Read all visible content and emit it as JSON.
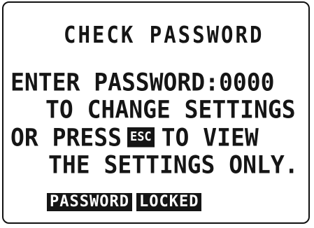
{
  "screen": {
    "title": "CHECK PASSWORD",
    "line1": "ENTER PASSWORD:0000",
    "line2": "TO CHANGE SETTINGS",
    "line3_prefix": "OR PRESS",
    "line3_key": "ESC",
    "line3_suffix": "TO VIEW",
    "line4": "THE SETTINGS ONLY.",
    "status_word1": "PASSWORD",
    "status_word2": "LOCKED"
  }
}
